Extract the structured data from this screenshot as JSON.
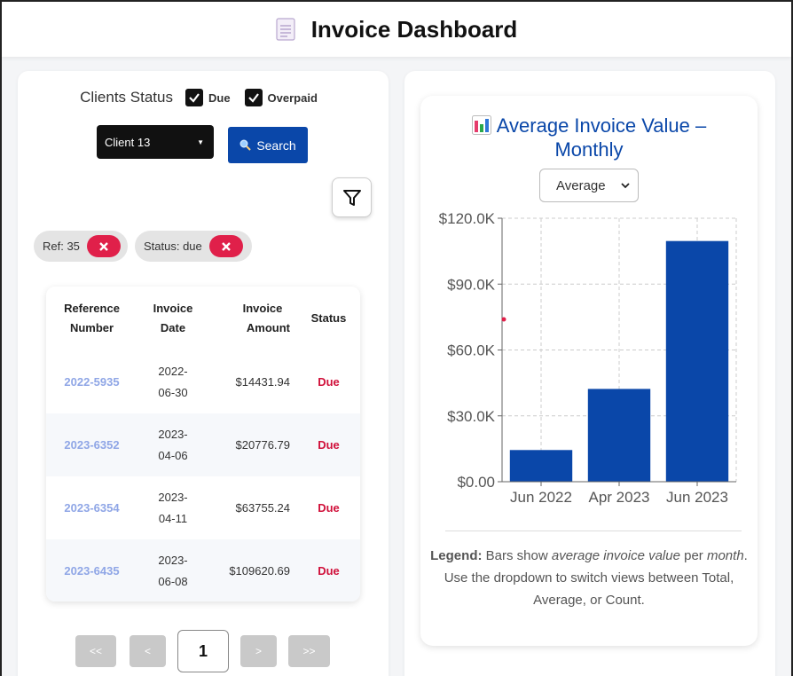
{
  "header": {
    "title": "Invoice Dashboard",
    "icon": "document-icon"
  },
  "filters": {
    "label": "Clients Status",
    "checkboxes": [
      {
        "label": "Due",
        "checked": true
      },
      {
        "label": "Overpaid",
        "checked": true
      }
    ],
    "client_select": "Client 13",
    "search_label": "Search",
    "chips": [
      {
        "label": "Ref: 35"
      },
      {
        "label": "Status: due"
      }
    ]
  },
  "table": {
    "headers": {
      "ref_1": "Reference",
      "ref_2": "Number",
      "date_1": "Invoice",
      "date_2": "Date",
      "amount_1": "Invoice",
      "amount_2": "Amount",
      "status": "Status"
    },
    "rows": [
      {
        "ref": "2022-5935",
        "date_1": "2022-",
        "date_2": "06-30",
        "amount": "$14431.94",
        "status": "Due"
      },
      {
        "ref": "2023-6352",
        "date_1": "2023-",
        "date_2": "04-06",
        "amount": "$20776.79",
        "status": "Due"
      },
      {
        "ref": "2023-6354",
        "date_1": "2023-",
        "date_2": "04-11",
        "amount": "$63755.24",
        "status": "Due"
      },
      {
        "ref": "2023-6435",
        "date_1": "2023-",
        "date_2": "06-08",
        "amount": "$109620.69",
        "status": "Due"
      }
    ]
  },
  "pagination": {
    "first": "<<",
    "prev": "<",
    "current": "1",
    "next": ">",
    "last": ">>"
  },
  "chart": {
    "title_line1": "Average Invoice Value –",
    "title_line2": "Monthly",
    "view_selected": "Average",
    "legend_bold": "Legend:",
    "legend_text1": " Bars show ",
    "legend_em1": "average invoice value",
    "legend_text2": " per ",
    "legend_em2": "month",
    "legend_text3": ".",
    "legend_line2": "Use the dropdown to switch views between Total, Average, or Count.",
    "colors": {
      "bar": "#0a47a9",
      "title": "#0a47a9"
    }
  },
  "chart_data": {
    "type": "bar",
    "categories": [
      "Jun 2022",
      "Apr 2023",
      "Jun 2023"
    ],
    "values": [
      14431.94,
      42266.02,
      109620.69
    ],
    "yticks": [
      "$0.00",
      "$30.0K",
      "$60.0K",
      "$90.0K",
      "$120.0K"
    ],
    "ylim": [
      0,
      120000
    ],
    "grid": true
  }
}
